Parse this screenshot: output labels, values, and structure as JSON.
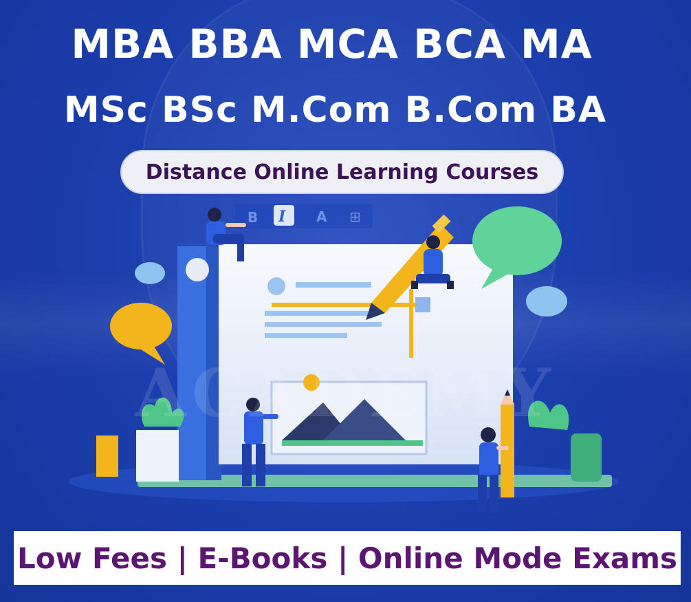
{
  "headline": {
    "line1": "MBA BBA  MCA BCA  MA",
    "line2": "MSc  BSc  M.Com B.Com BA"
  },
  "tagline": "Distance Online Learning Courses",
  "footer": "Low Fees | E-Books | Online Mode Exams",
  "watermark": "ACADEMY",
  "colors": {
    "background": "#1c3fae",
    "headline": "#ffffff",
    "tagline_text": "#3c1456",
    "footer_text": "#5a1670",
    "accent_yellow": "#f2b51c",
    "accent_green": "#4fc58a",
    "accent_lightblue": "#8fc3f0"
  },
  "toolbar_icons": [
    "bold-icon",
    "italic-icon",
    "text-color-icon",
    "table-icon"
  ],
  "toolbar_glyphs": [
    "B",
    "I",
    "A",
    "⊞"
  ]
}
